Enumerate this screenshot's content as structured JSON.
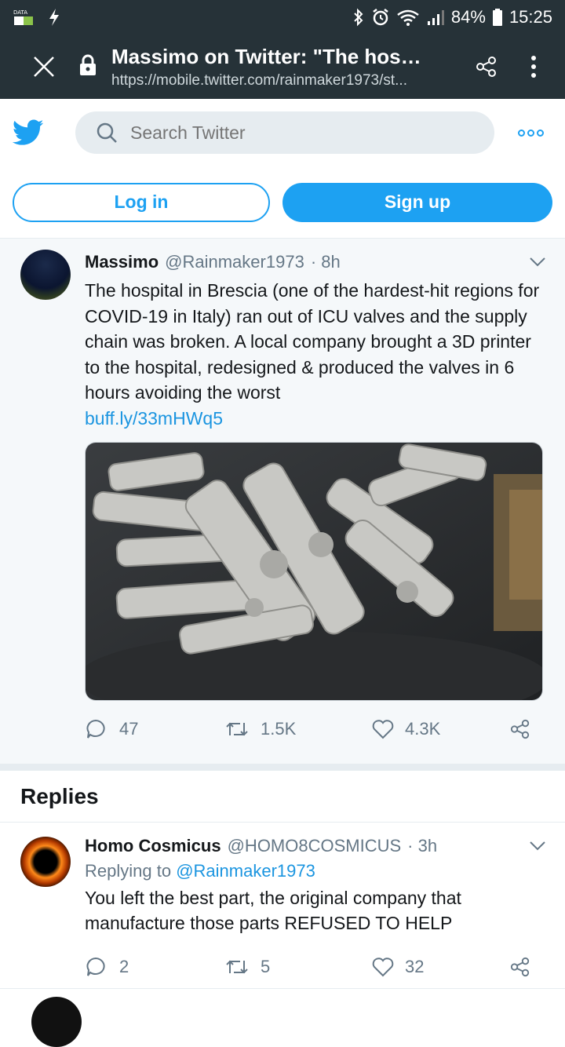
{
  "status": {
    "data_label": "DATA",
    "battery": "84%",
    "time": "15:25"
  },
  "browser": {
    "title": "Massimo on Twitter: \"The hospital...",
    "url": "https://mobile.twitter.com/rainmaker1973/st..."
  },
  "header": {
    "search_placeholder": "Search Twitter"
  },
  "auth": {
    "login": "Log in",
    "signup": "Sign up"
  },
  "tweet": {
    "name": "Massimo",
    "handle": "@Rainmaker1973",
    "time": "· 8h",
    "text": "The hospital in Brescia (one of the hardest-hit regions for COVID-19 in Italy) ran out of ICU valves and the supply chain was broken. A local company brought a 3D printer to the hospital, redesigned & produced the valves in 6 hours avoiding the worst",
    "link": "buff.ly/33mHWq5",
    "replies": "47",
    "retweets": "1.5K",
    "likes": "4.3K"
  },
  "replies_section": {
    "heading": "Replies"
  },
  "reply1": {
    "name": "Homo Cosmicus",
    "handle": "@HOMO8COSMICUS",
    "time": "· 3h",
    "replying_label": "Replying to",
    "replying_to": "@Rainmaker1973",
    "text": "You left the best part, the original company that manufacture those parts REFUSED TO HELP",
    "replies": "2",
    "retweets": "5",
    "likes": "32"
  },
  "colors": {
    "brand": "#1da1f2",
    "status_bar": "#263238"
  }
}
